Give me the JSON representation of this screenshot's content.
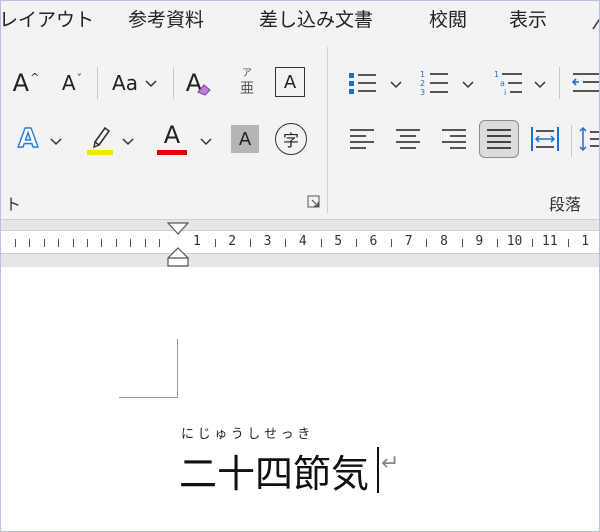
{
  "menu": {
    "tabs": [
      "レイアウト",
      "参考資料",
      "差し込み文書",
      "校閲",
      "表示"
    ]
  },
  "ribbon": {
    "font_group_label": "ト",
    "paragraph_group_label": "段落",
    "grow_font_glyph": "A",
    "shrink_font_glyph": "A",
    "change_case_label": "Aa",
    "clear_format_glyph": "A",
    "phonetic_top": "ア",
    "phonetic_bottom": "亜",
    "char_border_glyph": "A",
    "text_effect_glyph": "A",
    "font_color_glyph": "A",
    "char_shading_glyph": "A",
    "enclose_char_glyph": "字",
    "colors": {
      "highlight": "#f5e800",
      "font_color": "#e00000",
      "text_effect": "#2f7fd8",
      "accent_blue": "#1f6fd1"
    }
  },
  "ruler": {
    "numbers": [
      "1",
      "2",
      "3",
      "4",
      "5",
      "6",
      "7",
      "8",
      "9",
      "10",
      "11",
      "1"
    ]
  },
  "document": {
    "ruby_text": "にじゅうしせっき",
    "body_text": "二十四節気",
    "return_mark": "↵"
  }
}
